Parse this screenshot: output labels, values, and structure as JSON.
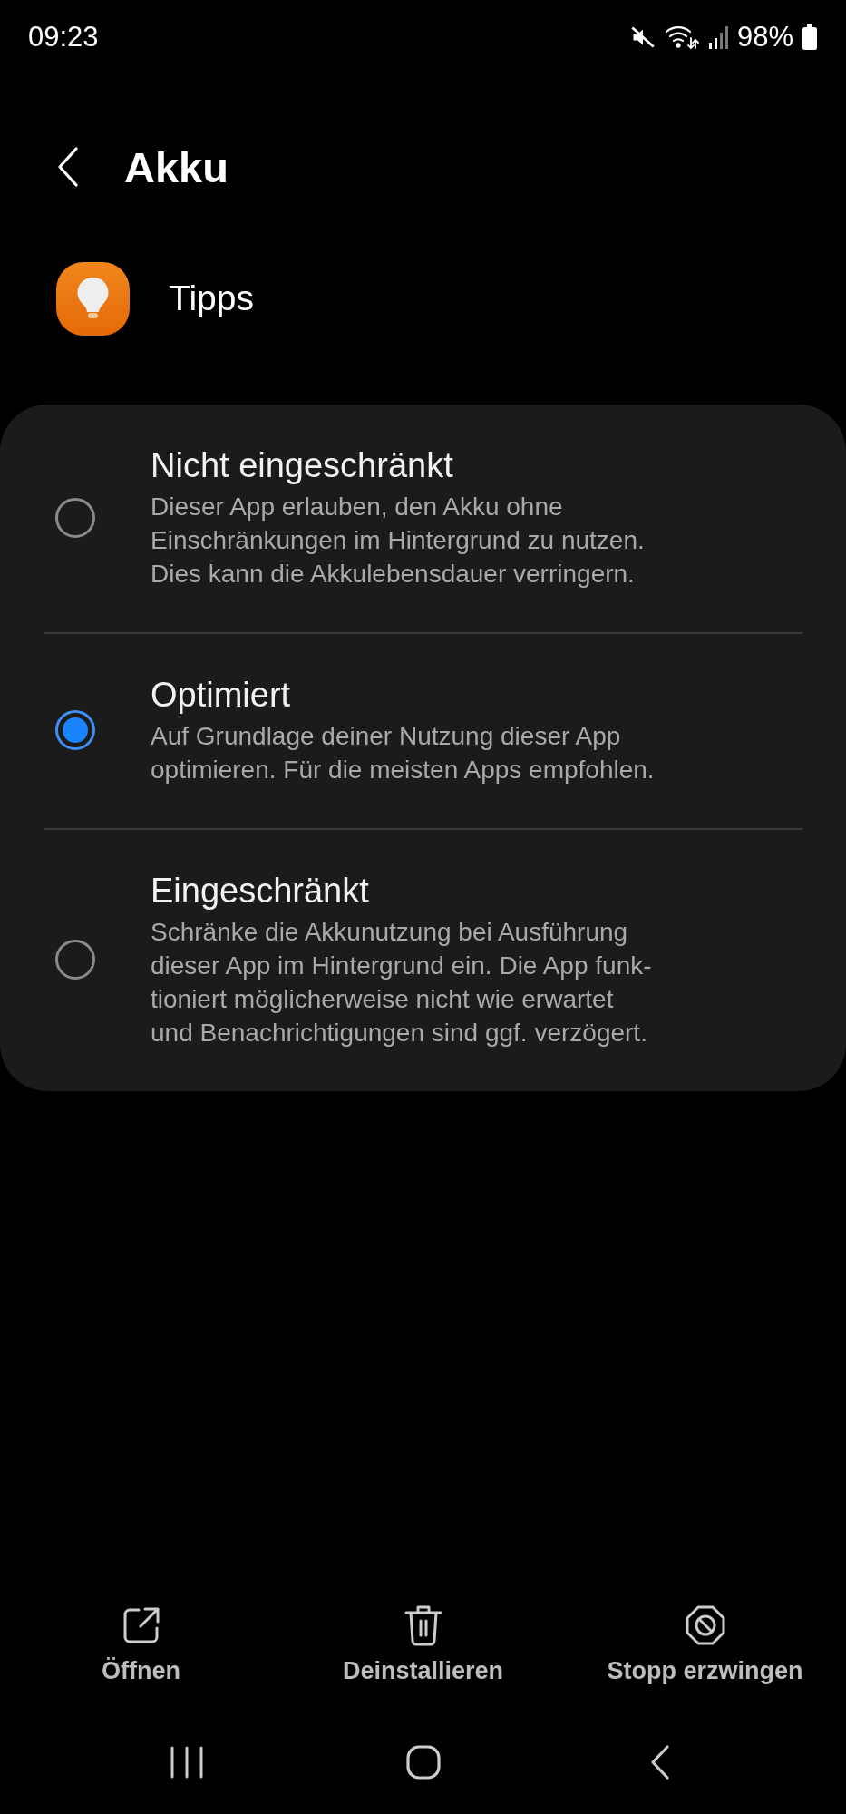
{
  "status_bar": {
    "time": "09:23",
    "battery": "98%"
  },
  "header": {
    "title": "Akku"
  },
  "app": {
    "name": "Tipps"
  },
  "options": [
    {
      "title": "Nicht eingeschränkt",
      "description": "Dieser App erlauben, den Akku ohne\nEinschränkungen im Hintergrund zu nutzen.\nDies kann die Akkulebensdauer verringern.",
      "selected": false
    },
    {
      "title": "Optimiert",
      "description": "Auf Grundlage deiner Nutzung dieser App\noptimieren. Für die meisten Apps empfohlen.",
      "selected": true
    },
    {
      "title": "Eingeschränkt",
      "description": "Schränke die Akkunutzung bei Ausführung\ndieser App im Hintergrund ein. Die App funk-\ntioniert möglicherweise nicht wie erwartet\nund Benachrichtigungen sind ggf. verzögert.",
      "selected": false
    }
  ],
  "actions": [
    {
      "label": "Öffnen",
      "kind": "open"
    },
    {
      "label": "Deinstallieren",
      "kind": "uninstall"
    },
    {
      "label": "Stopp erzwingen",
      "kind": "stop"
    }
  ]
}
